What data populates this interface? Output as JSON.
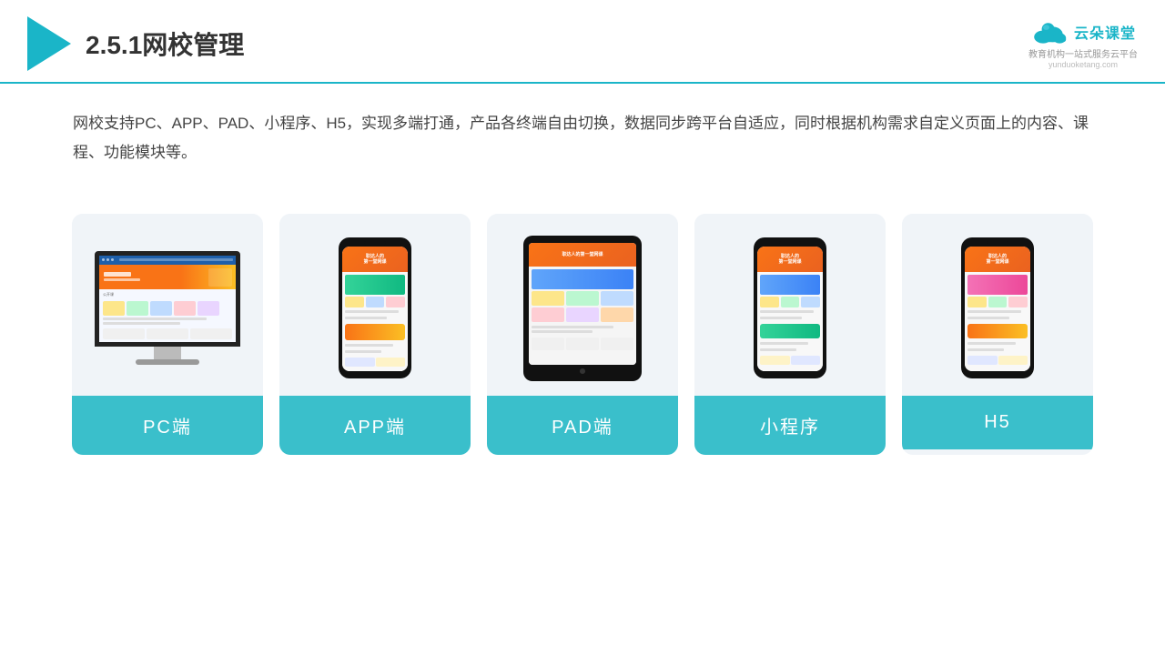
{
  "header": {
    "title": "2.5.1网校管理",
    "brand": {
      "name": "云朵课堂",
      "slogan": "教育机构一站式服务云平台",
      "url": "yunduoketang.com"
    }
  },
  "description": {
    "text": "网校支持PC、APP、PAD、小程序、H5，实现多端打通，产品各终端自由切换，数据同步跨平台自适应，同时根据机构需求自定义页面上的内容、课程、功能模块等。"
  },
  "cards": [
    {
      "id": "pc",
      "label": "PC端"
    },
    {
      "id": "app",
      "label": "APP端"
    },
    {
      "id": "pad",
      "label": "PAD端"
    },
    {
      "id": "miniprogram",
      "label": "小程序"
    },
    {
      "id": "h5",
      "label": "H5"
    }
  ],
  "colors": {
    "accent": "#3abfcb",
    "border": "#1ab5c8",
    "card_bg": "#f0f4f8"
  }
}
